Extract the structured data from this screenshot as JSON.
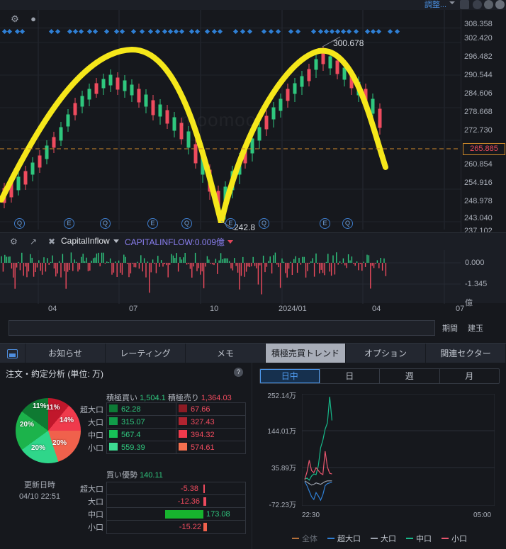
{
  "top_strip": {
    "adjust_label": "調整..."
  },
  "price_chart": {
    "toolbar": {
      "gear_icon": "gear-icon",
      "bulb_icon": "bulb-icon"
    },
    "annotations": {
      "high": "300.678",
      "low": "242.8"
    },
    "current_price": "265.885",
    "axis_labels": [
      "308.358",
      "302.420",
      "296.482",
      "290.544",
      "284.606",
      "278.668",
      "272.730",
      "260.854",
      "254.916",
      "248.978",
      "243.040",
      "237.102"
    ],
    "event_badges": [
      "Q",
      "E",
      "Q",
      "E",
      "Q",
      "E",
      "Q",
      "E",
      "Q"
    ],
    "watermark": "moomoo",
    "drawn_curve_color": "#f5e71a",
    "current_price_line_color": "#d08a2a"
  },
  "sub_chart": {
    "gear_icon": "gear-icon",
    "expand_icon": "expand-icon",
    "close_icon": "close-icon",
    "indicator_name": "CapitalInflow",
    "indicator_value": "CAPITALINFLOW:0.009億",
    "axis_labels": [
      "0.000",
      "-1.345",
      "億"
    ]
  },
  "time_axis": {
    "ticks": [
      "04",
      "07",
      "10",
      "2024/01",
      "04",
      "07"
    ]
  },
  "range_controls": {
    "period_label": "期間",
    "position_label": "建玉"
  },
  "tabbar": {
    "items": [
      {
        "label": "お知らせ",
        "active": false
      },
      {
        "label": "レーティング",
        "active": false
      },
      {
        "label": "メモ",
        "active": false
      },
      {
        "label": "積極売買トレンド",
        "active": true
      },
      {
        "label": "オプション",
        "active": false
      },
      {
        "label": "関連セクター",
        "active": false
      }
    ]
  },
  "order_analysis": {
    "title": "注文・約定分析 (単位: 万)",
    "help_icon": "help-icon",
    "buy_header_label": "積極買い",
    "buy_header_value": "1,504.1",
    "sell_header_label": "積極売り",
    "sell_header_value": "1,364.03",
    "rows": [
      {
        "label": "超大口",
        "buy": "62.28",
        "sell": "67.66",
        "buy_color": "#0d7a36",
        "sell_color": "#8c1b24"
      },
      {
        "label": "大口",
        "buy": "315.07",
        "sell": "327.43",
        "buy_color": "#119c49",
        "sell_color": "#b02430"
      },
      {
        "label": "中口",
        "buy": "567.4",
        "sell": "394.32",
        "buy_color": "#17c057",
        "sell_color": "#f03a4c"
      },
      {
        "label": "小口",
        "buy": "559.39",
        "sell": "574.61",
        "buy_color": "#3ddb92",
        "sell_color": "#f5704f"
      }
    ],
    "advantage_label": "買い優勢",
    "advantage_value": "140.11",
    "update_label": "更新日時",
    "update_time": "04/10 22:51",
    "net_rows": [
      {
        "label": "超大口",
        "value": "-5.38",
        "negative": true
      },
      {
        "label": "大口",
        "value": "-12.36",
        "negative": true
      },
      {
        "label": "中口",
        "value": "173.08",
        "negative": false
      },
      {
        "label": "小口",
        "value": "-15.22",
        "negative": true
      }
    ],
    "pie": {
      "slices": [
        {
          "label": "11%",
          "color": "#c1172b"
        },
        {
          "label": "14%",
          "color": "#f03a4c"
        },
        {
          "label": "20%",
          "color": "#f0614c"
        },
        {
          "label": "20%",
          "color": "#2fd68a"
        },
        {
          "label": "20%",
          "color": "#1cb34b"
        },
        {
          "label": "11%",
          "color": "#0f7a32"
        }
      ]
    }
  },
  "trend_chart": {
    "range_tabs": [
      {
        "label": "日中",
        "active": true
      },
      {
        "label": "日",
        "active": false
      },
      {
        "label": "週",
        "active": false
      },
      {
        "label": "月",
        "active": false
      }
    ],
    "legend": [
      {
        "label": "全体",
        "color": "#b5703a",
        "dimmed": true
      },
      {
        "label": "超大口",
        "color": "#2f7fd4",
        "dimmed": false
      },
      {
        "label": "大口",
        "color": "#9aa0ab",
        "dimmed": false
      },
      {
        "label": "中口",
        "color": "#17b98a",
        "dimmed": false
      },
      {
        "label": "小口",
        "color": "#e8566e",
        "dimmed": false
      }
    ],
    "chart_data": {
      "type": "line",
      "title": "",
      "xlabel": "",
      "ylabel": "",
      "ylim": [
        -72.23,
        252.14
      ],
      "ytick_labels": [
        "252.14万",
        "144.01万",
        "35.89万",
        "-72.23万"
      ],
      "ytick_values": [
        252.14,
        144.01,
        35.89,
        -72.23
      ],
      "xtick_labels": [
        "22:30",
        "05:00"
      ],
      "grid": true,
      "legend_position": "bottom",
      "series": [
        {
          "name": "中口",
          "color": "#17b98a",
          "x": [
            0,
            1,
            2,
            3,
            4,
            5,
            6,
            7,
            8,
            9,
            10,
            11,
            12
          ],
          "values": [
            5,
            8,
            2,
            14,
            20,
            18,
            44,
            96,
            118,
            150,
            168,
            244,
            175
          ]
        },
        {
          "name": "小口",
          "color": "#e8566e",
          "x": [
            0,
            1,
            2,
            3,
            4,
            5,
            6,
            7,
            8,
            9,
            10,
            11,
            12
          ],
          "values": [
            4,
            26,
            60,
            30,
            24,
            38,
            30,
            22,
            18,
            86,
            40,
            22,
            20
          ]
        },
        {
          "name": "超大口",
          "color": "#2f7fd4",
          "x": [
            0,
            1,
            2,
            3,
            4,
            5,
            6,
            7,
            8,
            9,
            10,
            11,
            12
          ],
          "values": [
            -2,
            -14,
            -30,
            -46,
            -54,
            -34,
            -44,
            -56,
            -40,
            -14,
            -8,
            -6,
            -4
          ]
        },
        {
          "name": "大口",
          "color": "#9aa0ab",
          "x": [
            0,
            1,
            2,
            3,
            4,
            5,
            6,
            7,
            8,
            9,
            10,
            11,
            12
          ],
          "values": [
            0,
            -4,
            -8,
            -12,
            -10,
            -6,
            -8,
            -10,
            -6,
            -2,
            0,
            0,
            0
          ]
        }
      ]
    }
  }
}
